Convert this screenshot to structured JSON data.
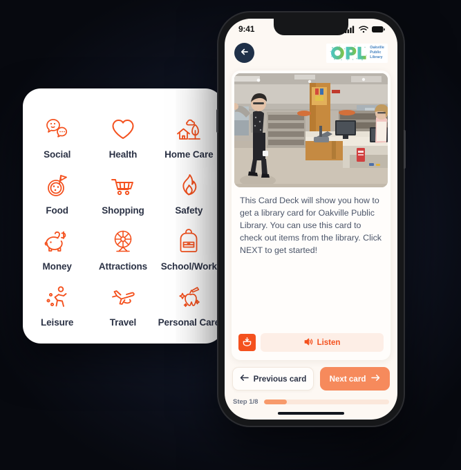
{
  "categories": {
    "items": [
      {
        "label": "Social",
        "icon": "speech-bubbles-icon"
      },
      {
        "label": "Health",
        "icon": "heart-icon"
      },
      {
        "label": "Home Care",
        "icon": "house-tree-icon"
      },
      {
        "label": "Food",
        "icon": "pizza-icon"
      },
      {
        "label": "Shopping",
        "icon": "shopping-cart-icon"
      },
      {
        "label": "Safety",
        "icon": "flame-icon"
      },
      {
        "label": "Money",
        "icon": "piggy-bank-icon"
      },
      {
        "label": "Attractions",
        "icon": "ferris-wheel-icon"
      },
      {
        "label": "School/Work",
        "icon": "backpack-icon"
      },
      {
        "label": "Leisure",
        "icon": "running-person-icon"
      },
      {
        "label": "Travel",
        "icon": "airplane-icon"
      },
      {
        "label": "Personal Care",
        "icon": "tooth-brush-icon"
      }
    ]
  },
  "phone": {
    "status_bar": {
      "time": "9:41",
      "icons": [
        "cellular-signal-icon",
        "wifi-icon",
        "battery-icon"
      ]
    },
    "header": {
      "back_icon": "back-arrow-icon",
      "logo_mark": "OPL",
      "logo_line1": "Oakville",
      "logo_line2": "Public",
      "logo_line3": "Library"
    },
    "card": {
      "photo_alt": "library-interior-photo",
      "body_text": "This Card Deck will show you how to get a library card for Oakville Public Library. You can use this card to check out items from the library. Click NEXT to get started!",
      "tts_icon": "text-to-speech-icon",
      "listen_label": "Listen",
      "listen_icon": "speaker-icon"
    },
    "nav": {
      "previous_label": "Previous card",
      "previous_icon": "arrow-left-icon",
      "next_label": "Next card",
      "next_icon": "arrow-right-icon"
    },
    "progress": {
      "step_label": "Step 1/8",
      "percent": 18
    }
  },
  "colors": {
    "accent_orange": "#f4511e",
    "next_orange": "#f68a5c",
    "progress_fill": "#f79a6b",
    "progress_track": "#fbe7da",
    "listen_bg": "#fdeee6",
    "text_dark": "#2b3245",
    "body_text": "#4a5468",
    "back_circle": "#1f3048",
    "screen_bg": "#fdf8f3",
    "page_bg": "#121829",
    "logo_teal": "#4cc3b0",
    "logo_green": "#7cc24a",
    "logo_blue": "#3e7dbd"
  }
}
